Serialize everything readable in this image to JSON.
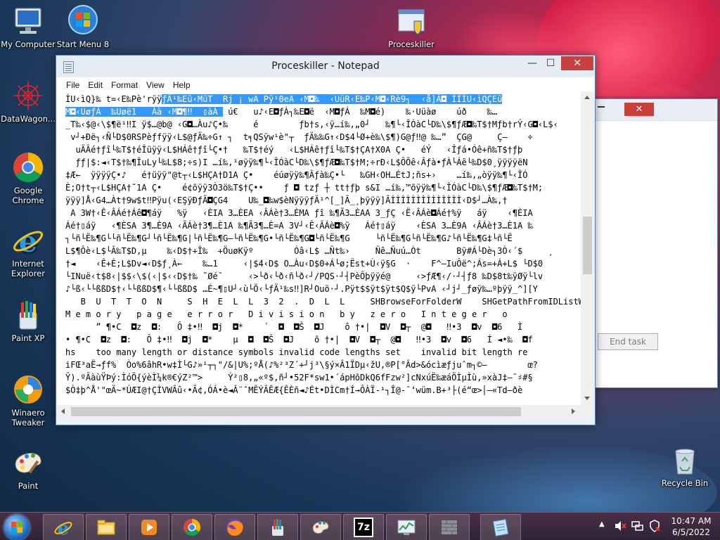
{
  "desktop": {
    "icons": [
      {
        "label": "My Computer",
        "icon": "computer-icon"
      },
      {
        "label": "Start Menu 8",
        "icon": "start-menu-icon"
      },
      {
        "label": "Proceskiller",
        "icon": "proceskiller-icon"
      },
      {
        "label": "DataWagon...",
        "icon": "datawagon-icon"
      },
      {
        "label": "Google Chrome",
        "icon": "chrome-icon"
      },
      {
        "label": "Internet Explorer",
        "icon": "ie-icon"
      },
      {
        "label": "Paint XP",
        "icon": "paint-xp-icon"
      },
      {
        "label": "Winaero Tweaker",
        "icon": "winaero-icon"
      },
      {
        "label": "Paint",
        "icon": "paint-icon"
      },
      {
        "label": "Recycle Bin",
        "icon": "recycle-bin-icon"
      }
    ]
  },
  "background_window": {
    "close": "✕",
    "end_task": "End task"
  },
  "notepad": {
    "title": "Proceskiller - Notepad",
    "controls": {
      "minimize": "—",
      "maximize": "☐",
      "close": "✕"
    },
    "menu": [
      "File",
      "Edit",
      "Format",
      "View",
      "Help"
    ],
    "content": {
      "line1_pre": "ÌU‹ìQ}‰ t=‹E‰Pè'rÿÿ",
      "line1_sel": "ƒÄ¹‰Eü‹MüT  Rj ¡ wA Pÿ¹0eA ‹M◘‰  ‹UüR‹E‰P‹M◘‹Rè9┐  ‹å]Â◘ ÌÌÌU‹ìQÇEü",
      "line2_sel": "M◘‹UøƒÁ  ‰Uøë1   Àà ‹M◘¶‼  ▯àÀ ",
      "line2_post": " ú€   u♪‹E◘ƒÀ┐‰E◘ë  ‹M◘ƒÁ  ‰M◘é)    ‰·Uüàø    úð    ‰…",
      "lines": [
        "_T‰‹$@‹\\$¶ë¹‼I ÿ$…@b@ ‹G◘…Àu♪Ç•‰     é        ƒb†s,‹ÿ…í‰,„0┘   ‰¶└‹ÎÓàC└D‰\\$¶ƒÆ◘‰T$†Mƒb†rÝ‹G◘‹L$‹",
        " v┘+Ðë┐‹Ñ└D$0RSPèƒfÿÿ‹L$@ƒÄ‰÷G↑ ┐  t╕QSÿw¹è\"┬  ƒÄ‰‰G↑‹D$4└Ø+è‰\\$¶)G@ƒ‼@ ‰…”  ÇG@     Ç—    ÷",
        "  uÄÂé†ƒî└‰T$†éÎüÿÿ‹L$HÁê†ƒî└Ç•†   ‰T$†éý   ‹L$HÁê†ƒî└‰T$†ÇA†X0A Ç•   éÝ   ‹Îƒá•Óê+ñ‰T$†ƒþ",
        "  ƒƒ|$:◄‹T$†‰¶ÎuLy└‰L$8;÷s)I …í‰,¹øÿÿ‰¶└‹ÎÓàC└D‰\\$¶ƒÆ◘‰T$†M;÷rÐ‹L$ÔÕê‹Âƒà•ƒÀ└Áê└‰D$0¸ÿÿÿÿëN",
        "‡Æ←  ÿÿÿÿÇ•♪   é†üÿÿ\"@t┬‹L$HÇA†D1A Ç•    éúøÿÿ‰¶Âƒà‰Ç•└   ‰GH‹OH…ÉtJ;ñs+›    …í‰,„òÿÿ‰¶└‹ÎÓ",
        "È;O†t┬‹L$HÇA†˜1A Ç•    é¢õÿÿ3Ò3ö‰T$†Ç••    ƒ ◘ tzƒ ┼ tt†ƒþ s&I …í‰,™õÿÿ‰¶└‹ÎÓàC└D‰\\$¶ƒÆ◘‰T$†M;",
        "ÿÿÿ]Å‹G4…Àt†9w$t‼Pÿu(‹EŞÿÐƒÄ◘ÇG4    U‰_◘‰w$èNÿÿÿƒÄ¹^[_]Ã_¸þÿÿÿ]ÃÌÌÌÌÌÌÌÌÌÌÌÌÌÌ‹D$┘…À‰,†",
        " A 3W†‹Ê‹ÂÁé†Áê◘¶áÿ   %ÿ   ‹ÈIA 3…ÈEA ‹ÂÁè†3…ÈMA ƒî ‰¶Ã3…ÈAA 3_ƒÇ ‹Ë‹ÂÁè◘Áé†%ÿ   áÿ    ‹¶ÈIA",
        "Áé†▯áÿ   ‹¶ÈSA 3¶…È9A ‹ÃÁè†3¶…È1A ‰¶Ã3¶…È=A 3V┘‹Ê‹ÂÁè◘%ÿ   Áé†▯áÿ    ‹ÈSA 3…È9A ‹ÂÁè†3…È1A ‰",
        "┐└ñ└Ë‰¶G└└ñ└Ë‰¶G┘└ñ└Ë‰¶G|└ñ└Ë‰¶G—└ñ└Ë‰¶G•└ñ└Ë‰¶G◘└ñ└Ë‰¶G     └ñ└Ë‰¶G└ñ└Ë‰¶G♪└ñ└Ë‰¶G‡└ñ└Ë",
        "L$¶Ôè‹L$└Â‰T$D,µ    ‰‹D$†+Î‰  +ÖuøKÿº        Óâ‹L$ …Ñt‰›     Ñê…Ñuú…Òt       Bÿ#Á└Dè┐3Ò‹´$     ¸",
        "†◄    ‹Ê+È;L$Dv◄‹D$ƒ¸À←    ‰…1     ‹|$4‹D$ O…Àu‹D$0+Á└ø;Ëst+Ù‹ÿ§G  ·    F^—IuÔë^;Ás=+Á+L$ └D$0",
        "└INuë‹t$8‹|$$‹\\$(‹|$‹‹D$†‰ ˜Øé¯     ‹>└ð‹└ð‹ñ└ð‹┘/PQS·┘┤PèÔþÿÿé@     ‹>ƒÆ¶‹/·┘┤ƒ8 ‰D$8t‰ÿØÿ└lv",
        "♪└ß‹└└ßßD$†‹└└ßßD$¶‹└└ßßD$ …É~¶▯U┘‹ù└Ö‹└ƒÄ¹‰s‼]R┘Ouö·┘.Pÿt$$ÿt$ÿt$Q$ÿ└PvA ‹┘j┘_ƒøÿ‰…ºþÿÿ_^][Y",
        "   B  U  T  T  O  N     S  H  E  L  L  3  2  .  D  L  L     SHBrowseForFolderW    SHGetPathFromIDListW   \\",
        "M e m o r y   p a g e   e r r o r   D i v i s i o n   b y   z e r o   I n t e g e r   o",
        "      ” ¶•C  ◘z  ◘:   Ô ‡•‼  ◘j  ◘*    ´  ◘  ◘Š  ◘J    ô †•|  ◘V  ◘┬  @◘   ‼•3  ◘v  ◘6   Ì",
        "• ¶•C  ◘z  ◘:   Ô ‡•‼  ◘j  ◘*    µ  ◘  ◘Š  ◘J    õ †•|  ◘V  ◘┬  @◘   ‼•3  ◘v  ◘6   Í ◄•‰  ◘f",
        "hs    too many length or distance symbols invalid code lengths set    invalid bit length re",
        "iFŒ³aË→ƒf%  Òo%6âhR•w‡Ì└G♪»¹┬┐\"/&|U%;ºÅ(♪%²³Z´+┘j³\\§ý×Â1ÏDµ‹žU,®P[°Âd>&ócìæƒjuˆm┐©—        œ?",
        "Ÿ).ºÃàùŸÞý:ÌóÖ{ýèÌ¼k®€ýZ²™>     Ý²▯8,„«º$,ñ┘•52F*sw1•´ápHõDkQ6fFzw²]cNxúË‰æáÖÌµÌù,»xàJ‡–¯♯#§",
        "$Ò‡þ^Å'\"œÄ~*ÚÆI@†ÇÌVWÂû‹•Ã¢,ÓÁ•è◄Â¨ˆMËÝÂÊÆ{ÊÈñ◄♪Ét•DÌCm†Í→ÔÀÏ-¹┐Î@-¯‘wüm.B+³├(é“œ>│—«Td—ðè"
      ]
    }
  },
  "taskbar": {
    "apps": [
      "ie-icon",
      "file-explorer-icon",
      "media-player-icon",
      "chrome-icon",
      "firefox-icon",
      "paint-xp-icon",
      "paint-icon",
      "7zip-icon",
      "task-manager-icon",
      "firewall-icon",
      "notepad-icon"
    ],
    "sevenzip_label": "7z",
    "clock_time": "10:47 AM",
    "clock_date": "6/5/2022"
  }
}
